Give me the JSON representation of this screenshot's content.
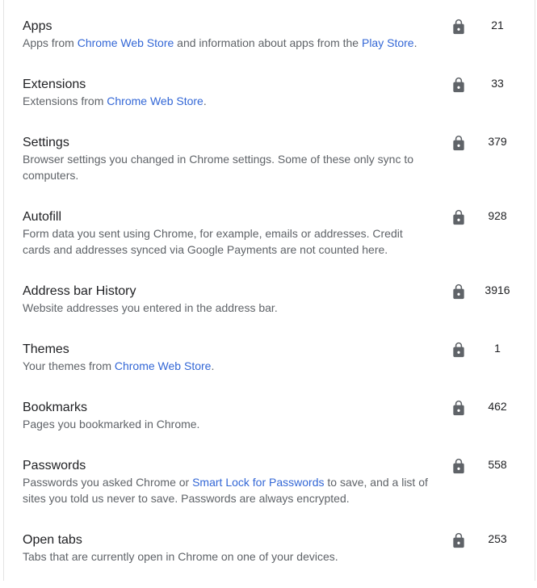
{
  "items": [
    {
      "title": "Apps",
      "desc_parts": [
        {
          "text": "Apps from "
        },
        {
          "text": "Chrome Web Store",
          "link": true
        },
        {
          "text": " and information about apps from the "
        },
        {
          "text": "Play Store",
          "link": true
        },
        {
          "text": "."
        }
      ],
      "count": "21"
    },
    {
      "title": "Extensions",
      "desc_parts": [
        {
          "text": "Extensions from "
        },
        {
          "text": "Chrome Web Store",
          "link": true
        },
        {
          "text": "."
        }
      ],
      "count": "33"
    },
    {
      "title": "Settings",
      "desc_parts": [
        {
          "text": "Browser settings you changed in Chrome settings. Some of these only sync to computers."
        }
      ],
      "count": "379"
    },
    {
      "title": "Autofill",
      "desc_parts": [
        {
          "text": "Form data you sent using Chrome, for example, emails or addresses. Credit cards and addresses synced via Google Payments are not counted here."
        }
      ],
      "count": "928"
    },
    {
      "title": "Address bar History",
      "desc_parts": [
        {
          "text": "Website addresses you entered in the address bar."
        }
      ],
      "count": "3916"
    },
    {
      "title": "Themes",
      "desc_parts": [
        {
          "text": "Your themes from "
        },
        {
          "text": "Chrome Web Store",
          "link": true
        },
        {
          "text": "."
        }
      ],
      "count": "1"
    },
    {
      "title": "Bookmarks",
      "desc_parts": [
        {
          "text": "Pages you bookmarked in Chrome."
        }
      ],
      "count": "462"
    },
    {
      "title": "Passwords",
      "desc_parts": [
        {
          "text": "Passwords you asked Chrome or "
        },
        {
          "text": "Smart Lock for Passwords",
          "link": true
        },
        {
          "text": " to save, and a list of sites you told us never to save. Passwords are always encrypted."
        }
      ],
      "count": "558"
    },
    {
      "title": "Open tabs",
      "desc_parts": [
        {
          "text": "Tabs that are currently open in Chrome on one of your devices."
        }
      ],
      "count": "253"
    }
  ],
  "icons": {
    "lock": "lock-icon"
  },
  "colors": {
    "link": "#3367d6",
    "title": "#202124",
    "description": "#5f6368",
    "icon": "#5f6368"
  }
}
